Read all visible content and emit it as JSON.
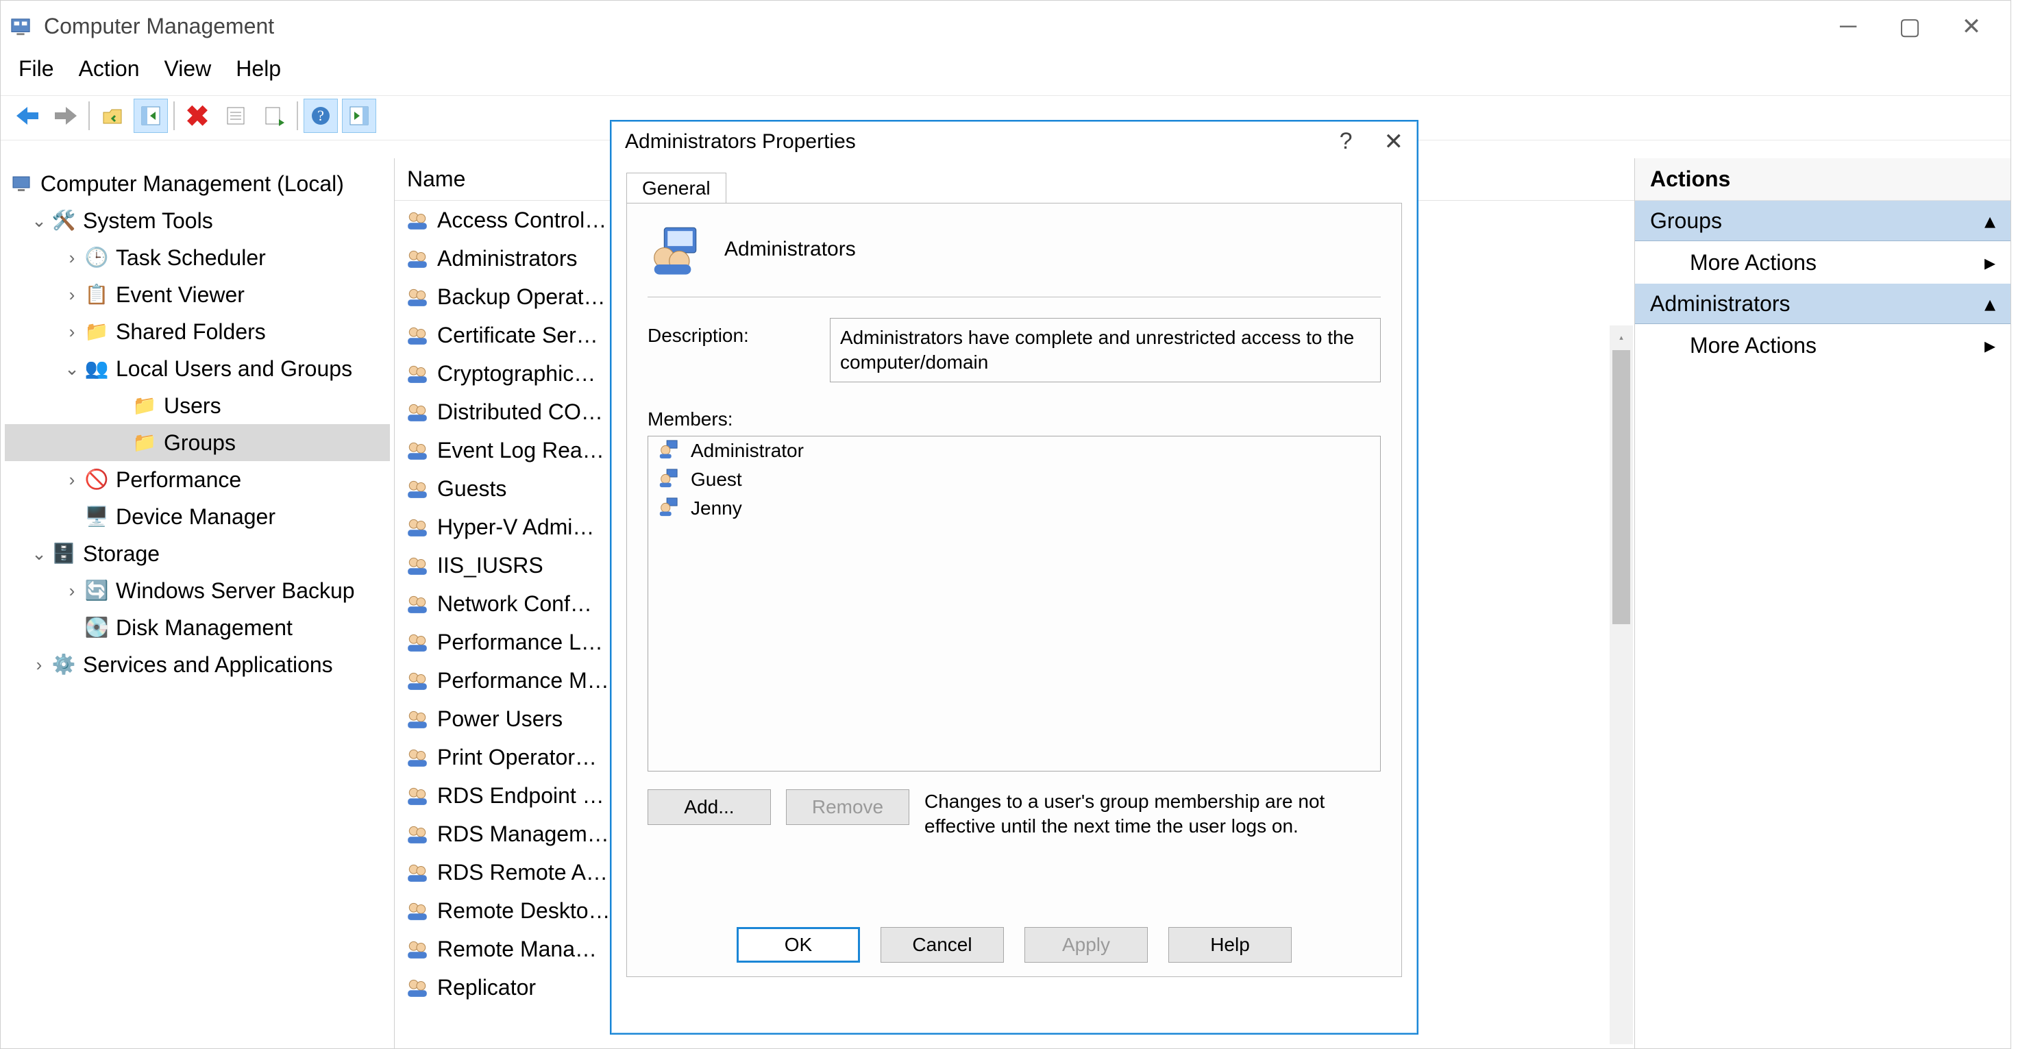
{
  "window": {
    "title": "Computer Management"
  },
  "menubar": [
    "File",
    "Action",
    "View",
    "Help"
  ],
  "tree": {
    "root": "Computer Management (Local)",
    "system_tools": "System Tools",
    "task_scheduler": "Task Scheduler",
    "event_viewer": "Event Viewer",
    "shared_folders": "Shared Folders",
    "local_users": "Local Users and Groups",
    "users": "Users",
    "groups": "Groups",
    "performance": "Performance",
    "device_manager": "Device Manager",
    "storage": "Storage",
    "server_backup": "Windows Server Backup",
    "disk_management": "Disk Management",
    "services_apps": "Services and Applications"
  },
  "list": {
    "header": "Name",
    "rows": [
      "Access Control…",
      "Administrators",
      "Backup Operat…",
      "Certificate Ser…",
      "Cryptographic…",
      "Distributed CO…",
      "Event Log Rea…",
      "Guests",
      "Hyper-V Admi…",
      "IIS_IUSRS",
      "Network Conf…",
      "Performance L…",
      "Performance M…",
      "Power Users",
      "Print Operator…",
      "RDS Endpoint …",
      "RDS Managem…",
      "RDS Remote A…",
      "Remote Deskto…",
      "Remote Mana…",
      "Replicator"
    ]
  },
  "actions": {
    "header": "Actions",
    "section1": "Groups",
    "more1": "More Actions",
    "section2": "Administrators",
    "more2": "More Actions"
  },
  "dialog": {
    "title": "Administrators Properties",
    "tab": "General",
    "group_name": "Administrators",
    "description_label": "Description:",
    "description_value": "Administrators have complete and unrestricted access to the computer/domain",
    "members_label": "Members:",
    "members": [
      "Administrator",
      "Guest",
      "Jenny"
    ],
    "add": "Add...",
    "remove": "Remove",
    "note": "Changes to a user's group membership are not effective until the next time the user logs on.",
    "ok": "OK",
    "cancel": "Cancel",
    "apply": "Apply",
    "help": "Help"
  }
}
